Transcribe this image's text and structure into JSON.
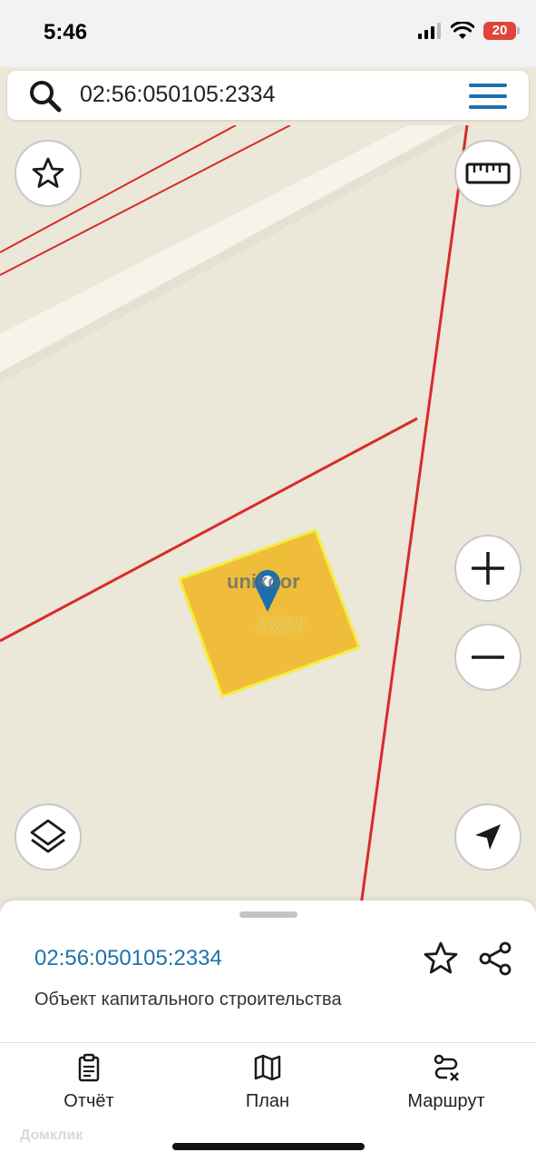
{
  "status_bar": {
    "time": "5:46",
    "battery_level": "20"
  },
  "search": {
    "query": "02:56:050105:2334"
  },
  "map": {
    "parcel_label": "2334",
    "watermark": "unikoor",
    "colors": {
      "parcel_fill": "#f0bd3a",
      "parcel_border": "#f5ee3a",
      "boundary": "#d92b2b",
      "road": "#f6f3ea",
      "pin": "#1c6fae",
      "background": "#ebe7d9"
    }
  },
  "controls": {
    "favorite": "star-icon",
    "ruler": "ruler-icon",
    "zoom_in": "plus-icon",
    "zoom_out": "minus-icon",
    "layers": "layers-icon",
    "locate": "navigation-arrow-icon"
  },
  "sheet": {
    "title": "02:56:050105:2334",
    "subtitle": "Объект капитального строительства"
  },
  "tabs": [
    {
      "label": "Отчёт",
      "icon": "clipboard-icon"
    },
    {
      "label": "План",
      "icon": "map-icon"
    },
    {
      "label": "Маршрут",
      "icon": "route-icon"
    }
  ],
  "branding": {
    "watermark": "Домклик"
  }
}
